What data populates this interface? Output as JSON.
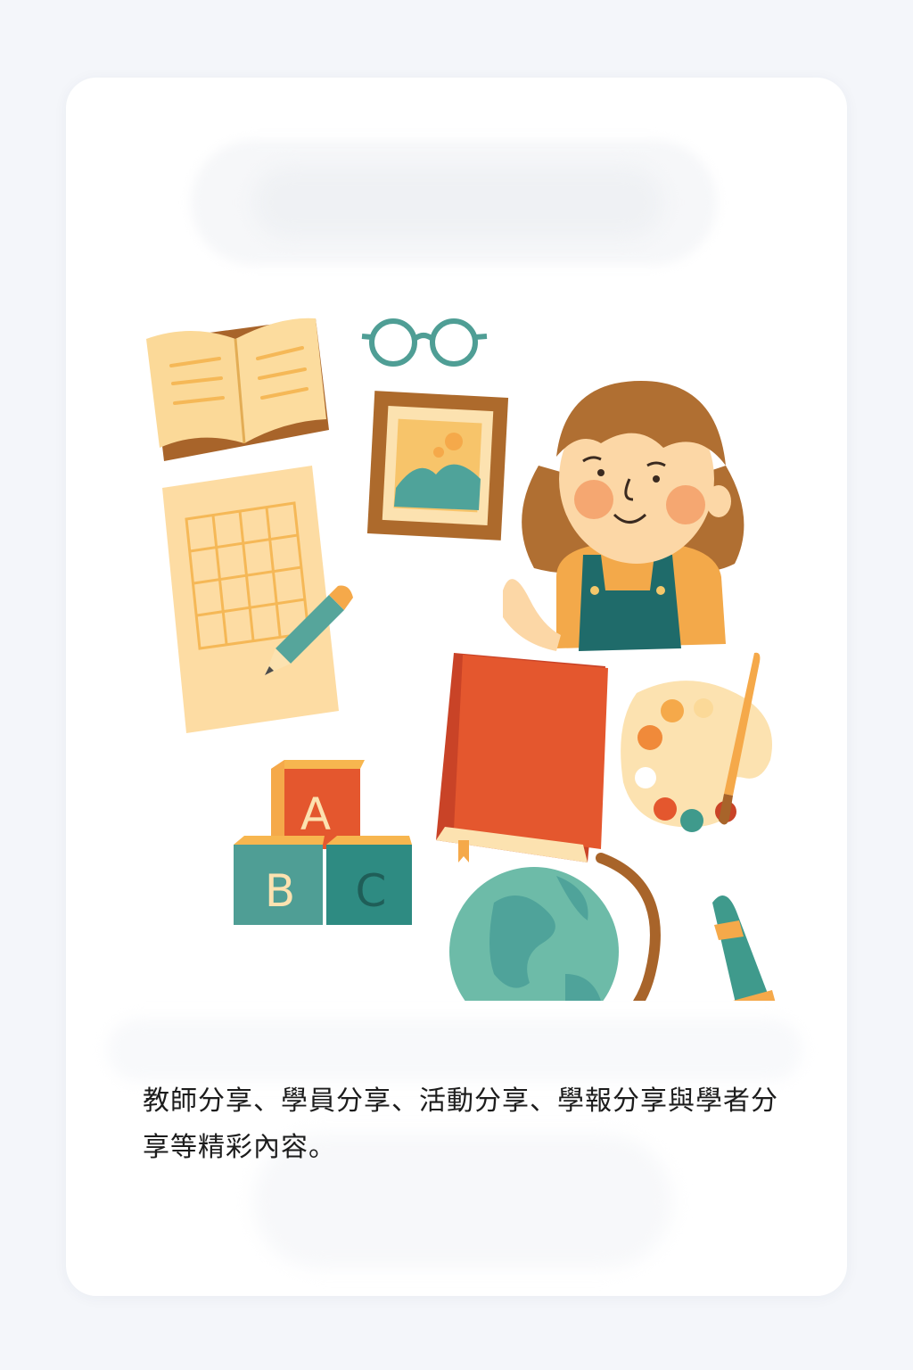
{
  "card": {
    "description": "教師分享、學員分享、活動分享、學報分享與學者分享等精彩內容。"
  },
  "illustration": {
    "blocks": [
      "A",
      "B",
      "C"
    ]
  },
  "colors": {
    "background": "#f4f6fa",
    "card": "#ffffff",
    "text": "#1c1c1c",
    "teal": "#3f9a8c",
    "orange": "#f5a94a",
    "red": "#e4572e",
    "brown": "#a8642a",
    "cream": "#fbd998"
  }
}
